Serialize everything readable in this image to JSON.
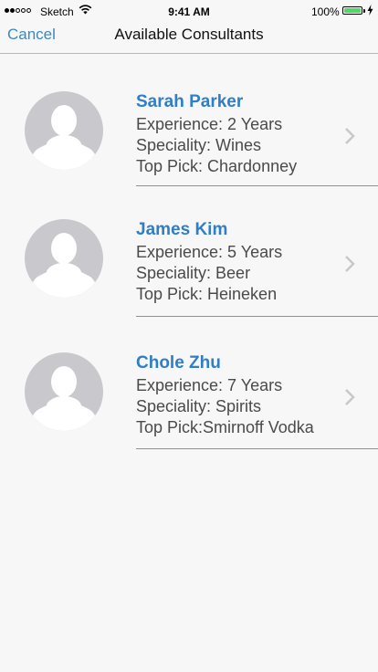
{
  "status_bar": {
    "carrier": "Sketch",
    "time": "9:41 AM",
    "battery_percent": "100%",
    "battery_color": "#4cd964"
  },
  "nav": {
    "cancel_label": "Cancel",
    "title": "Available Consultants"
  },
  "consultants": [
    {
      "name": "Sarah Parker",
      "experience": "Experience: 2 Years",
      "speciality": "Speciality: Wines",
      "top_pick": "Top Pick: Chardonney"
    },
    {
      "name": "James Kim",
      "experience": "Experience: 5 Years",
      "speciality": "Speciality: Beer",
      "top_pick": "Top Pick: Heineken"
    },
    {
      "name": "Chole Zhu",
      "experience": "Experience: 7 Years",
      "speciality": "Speciality: Spirits",
      "top_pick": "Top Pick:Smirnoff Vodka"
    }
  ],
  "colors": {
    "accent": "#2f7ec7",
    "link": "#3b88c3",
    "avatar_bg": "#c8c8cd"
  }
}
